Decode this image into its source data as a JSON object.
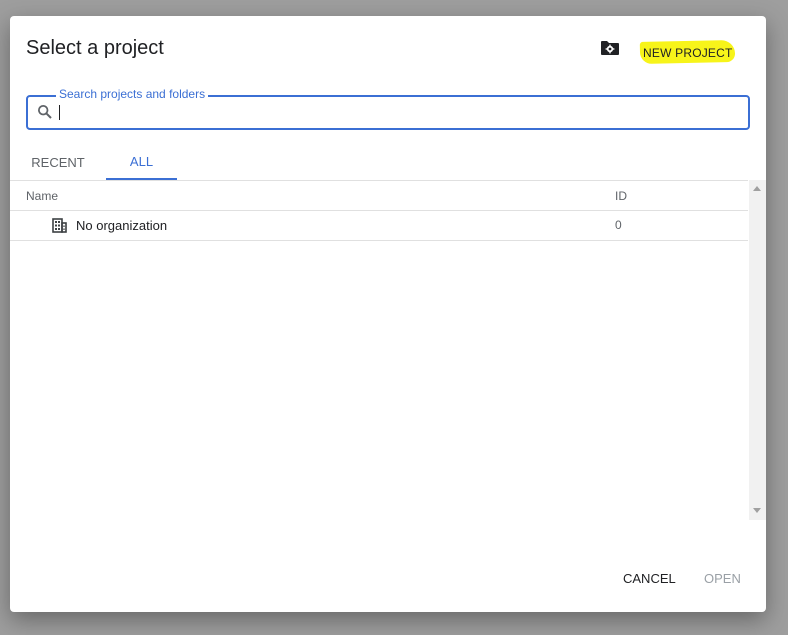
{
  "dialog": {
    "title": "Select a project",
    "new_project_label": "NEW PROJECT",
    "folder_icon": "folder-settings-icon",
    "highlight_color": "#f7f41a",
    "accent_color": "#3b6fd4"
  },
  "search": {
    "label": "Search projects and folders",
    "value": "",
    "icon": "search-icon"
  },
  "tabs": [
    {
      "label": "RECENT",
      "active": false
    },
    {
      "label": "ALL",
      "active": true
    }
  ],
  "table": {
    "columns": [
      "Name",
      "ID"
    ],
    "rows": [
      {
        "icon": "organization-icon",
        "name": "No organization",
        "id": "0"
      }
    ]
  },
  "footer": {
    "cancel_label": "CANCEL",
    "open_label": "OPEN"
  }
}
